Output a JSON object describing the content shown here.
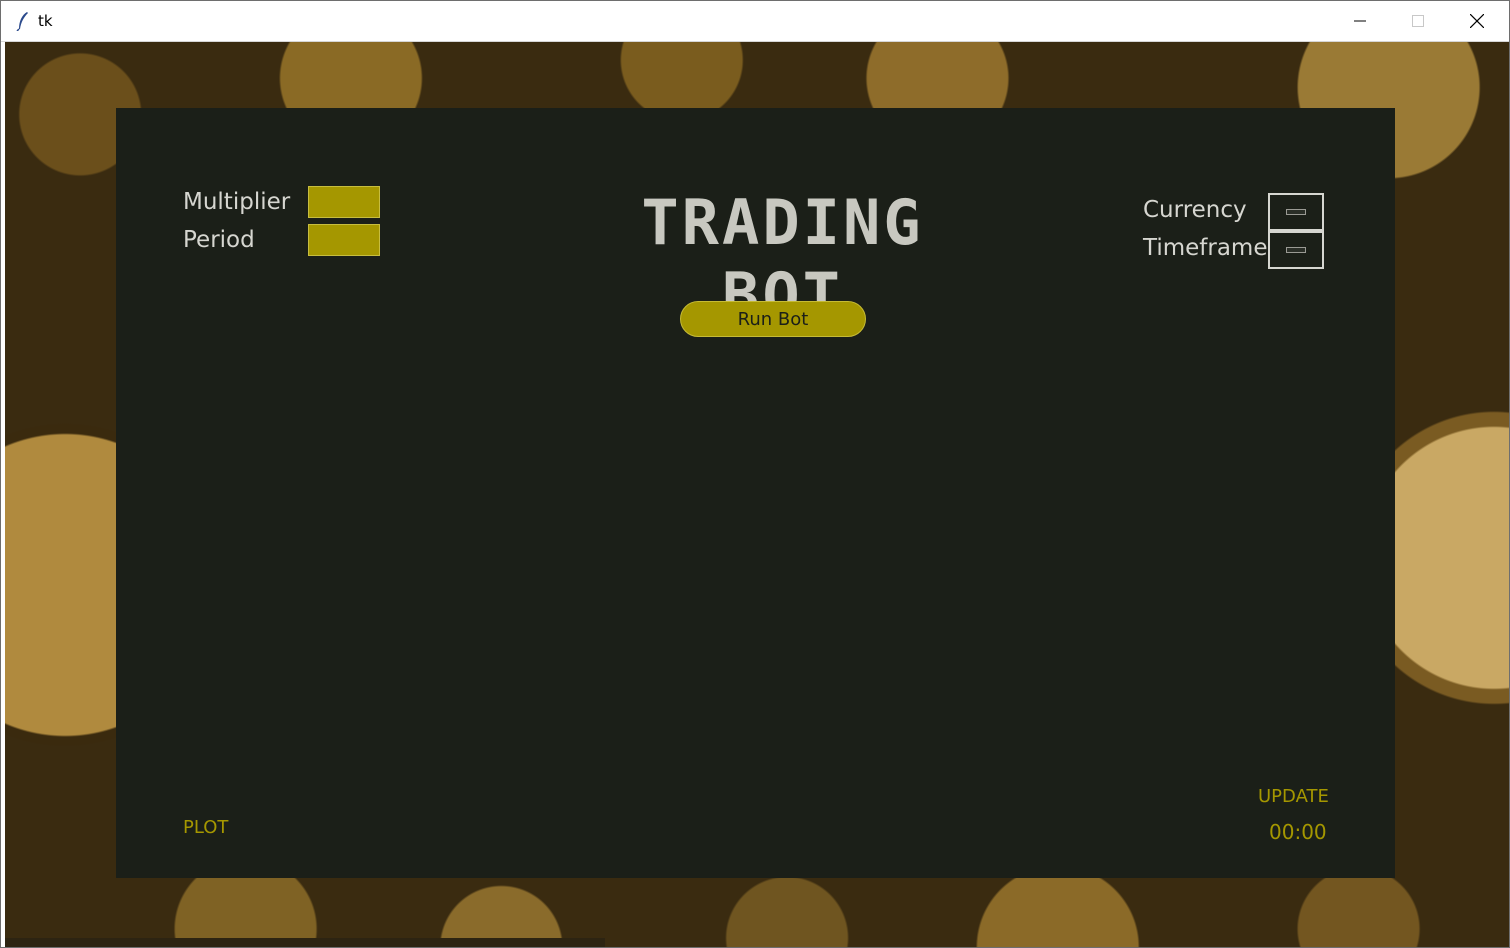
{
  "window": {
    "title": "tk",
    "icons": {
      "app": "feather-icon",
      "minimize": "minimize-icon",
      "maximize": "maximize-icon",
      "close": "close-icon"
    }
  },
  "panel": {
    "title": "TRADING BOT",
    "multiplier_label": "Multiplier",
    "period_label": "Period",
    "multiplier_value": "",
    "period_value": "",
    "currency_label": "Currency",
    "timeframe_label": "Timeframe",
    "run_button": "Run Bot",
    "plot_label": "PLOT",
    "update_label": "UPDATE",
    "update_time": "00:00"
  },
  "colors": {
    "panel_bg": "#1b1f18",
    "accent_yellow": "#a59700",
    "text_light": "#d6d6d0"
  }
}
